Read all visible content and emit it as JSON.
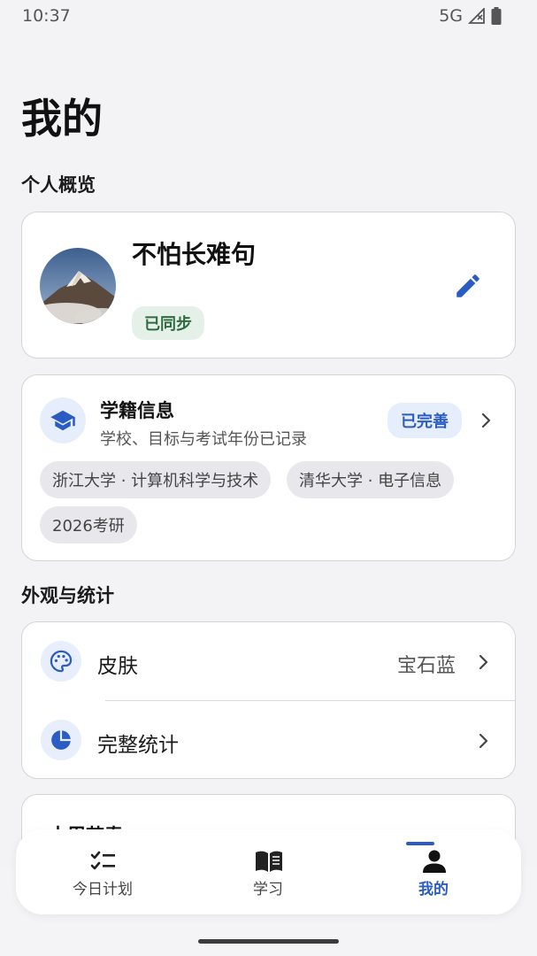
{
  "status_bar": {
    "time": "10:37",
    "network": "5G"
  },
  "page": {
    "title": "我的"
  },
  "sections": {
    "overview": "个人概览",
    "appearance": "外观与统计"
  },
  "profile": {
    "name": "不怕长难句",
    "sync_status": "已同步"
  },
  "school_info": {
    "title": "学籍信息",
    "subtitle": "学校、目标与考试年份已记录",
    "status": "已完善",
    "chips": [
      "浙江大学 · 计算机科学与技术",
      "清华大学 · 电子信息",
      "2026考研"
    ]
  },
  "settings": {
    "skin": {
      "label": "皮肤",
      "value": "宝石蓝"
    },
    "stats": {
      "label": "完整统计"
    }
  },
  "partial_card": {
    "title": "本周节奏"
  },
  "bottom_nav": {
    "items": [
      {
        "label": "今日计划",
        "icon": "checklist-icon"
      },
      {
        "label": "学习",
        "icon": "book-icon"
      },
      {
        "label": "我的",
        "icon": "person-icon"
      }
    ],
    "active_index": 2
  },
  "colors": {
    "accent": "#2b5cc4",
    "sync_green": "#2f6b40",
    "background": "#f3f3f6"
  }
}
